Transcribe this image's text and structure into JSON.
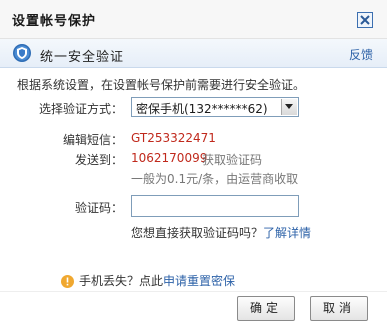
{
  "window": {
    "title": "设置帐号保护",
    "close_symbol": "X"
  },
  "header": {
    "title": "统一安全验证",
    "feedback_label": "反馈",
    "icon": "shield-icon"
  },
  "description": "根据系统设置，在设置帐号保护前需要进行安全验证。",
  "method": {
    "label": "选择验证方式：",
    "selected": "密保手机(132******62)"
  },
  "sms": {
    "edit_label": "编辑短信：",
    "edit_value": "GT253322471",
    "send_label": "发送到：",
    "send_number": "1062170099",
    "send_suffix": " 获取验证码",
    "fee_note": "一般为0.1元/条，由运营商收取"
  },
  "code": {
    "label": "验证码：",
    "value": "",
    "help_text": "您想直接获取验证码吗？",
    "help_link": "了解详情"
  },
  "footer": {
    "tip_text": "手机丢失？点此",
    "tip_link": "申请重置密保",
    "ok_label": "确定",
    "cancel_label": "取消"
  },
  "colors": {
    "link": "#2d62a8",
    "value_red": "#c0291c",
    "header_bg": "#e6eef8",
    "warn": "#f0a830"
  }
}
